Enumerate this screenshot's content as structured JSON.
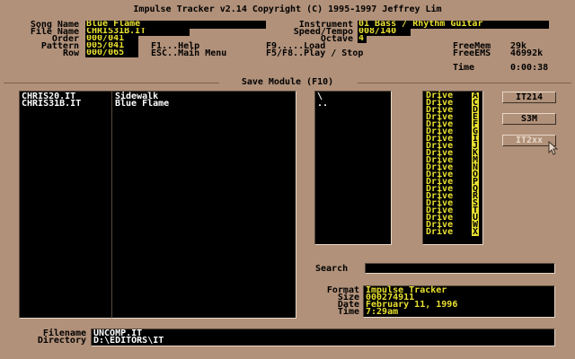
{
  "title": "Impulse Tracker v2.14 Copyright (C) 1995-1997 Jeffrey Lim",
  "song_info": {
    "song_name_label": "Song Name",
    "song_name": "Blue Flame",
    "file_name_label": "File Name",
    "file_name": "CHRIS31B.IT",
    "order_label": "Order",
    "order": "000/041",
    "pattern_label": "Pattern",
    "pattern": "005/041",
    "row_label": "Row",
    "row": "000/065"
  },
  "help": {
    "f1": "F1...Help",
    "esc": "ESC..Main Menu",
    "f9": "F9.....Load",
    "f5f8": "F5/F8..Play / Stop"
  },
  "instrument": {
    "instrument_label": "Instrument",
    "instrument": "01 Bass / Rhythm Guitar",
    "speed_label": "Speed/Tempo",
    "speed": "008/140",
    "octave_label": "Octave",
    "octave": "4"
  },
  "status": {
    "freemem_label": "FreeMem",
    "freemem": "29k",
    "freeems_label": "FreeEMS",
    "freeems": "46992k",
    "time_label": "Time",
    "time": "0:00:38"
  },
  "section_title": "Save Module (F10)",
  "files": [
    {
      "filename": "CHRIS20.IT",
      "songname": "Sidewalk"
    },
    {
      "filename": "CHRIS31B.IT",
      "songname": "Blue Flame"
    }
  ],
  "directories": [
    "\\",
    ".."
  ],
  "drives": [
    {
      "label": "Drive",
      "letter": "A"
    },
    {
      "label": "Drive",
      "letter": "C"
    },
    {
      "label": "Drive",
      "letter": "D"
    },
    {
      "label": "Drive",
      "letter": "E"
    },
    {
      "label": "Drive",
      "letter": "F"
    },
    {
      "label": "Drive",
      "letter": "G"
    },
    {
      "label": "Drive",
      "letter": "I"
    },
    {
      "label": "Drive",
      "letter": "J"
    },
    {
      "label": "Drive",
      "letter": "K"
    },
    {
      "label": "Drive",
      "letter": "M"
    },
    {
      "label": "Drive",
      "letter": "N"
    },
    {
      "label": "Drive",
      "letter": "O"
    },
    {
      "label": "Drive",
      "letter": "P"
    },
    {
      "label": "Drive",
      "letter": "Q"
    },
    {
      "label": "Drive",
      "letter": "R"
    },
    {
      "label": "Drive",
      "letter": "S"
    },
    {
      "label": "Drive",
      "letter": "T"
    },
    {
      "label": "Drive",
      "letter": "U"
    },
    {
      "label": "Drive",
      "letter": "W"
    },
    {
      "label": "Drive",
      "letter": "X"
    }
  ],
  "buttons": {
    "it214": "IT214",
    "s3m": "S3M",
    "it2xx": "IT2xx"
  },
  "search_label": "Search",
  "search_value": "",
  "details": {
    "format_label": "Format",
    "format": "Impulse Tracker",
    "size_label": "Size",
    "size": "000274911",
    "date_label": "Date",
    "date": "February 11, 1996",
    "time_label": "Time",
    "time": "7:29am"
  },
  "bottom": {
    "filename_label": "Filename",
    "filename": "UNCOMP.IT",
    "directory_label": "Directory",
    "directory": "D:\\EDITORS\\IT"
  },
  "colors": {
    "background": "#b1917a",
    "highlight": "#e8e030",
    "file_text": "#ffffff",
    "panel": "#000000"
  }
}
